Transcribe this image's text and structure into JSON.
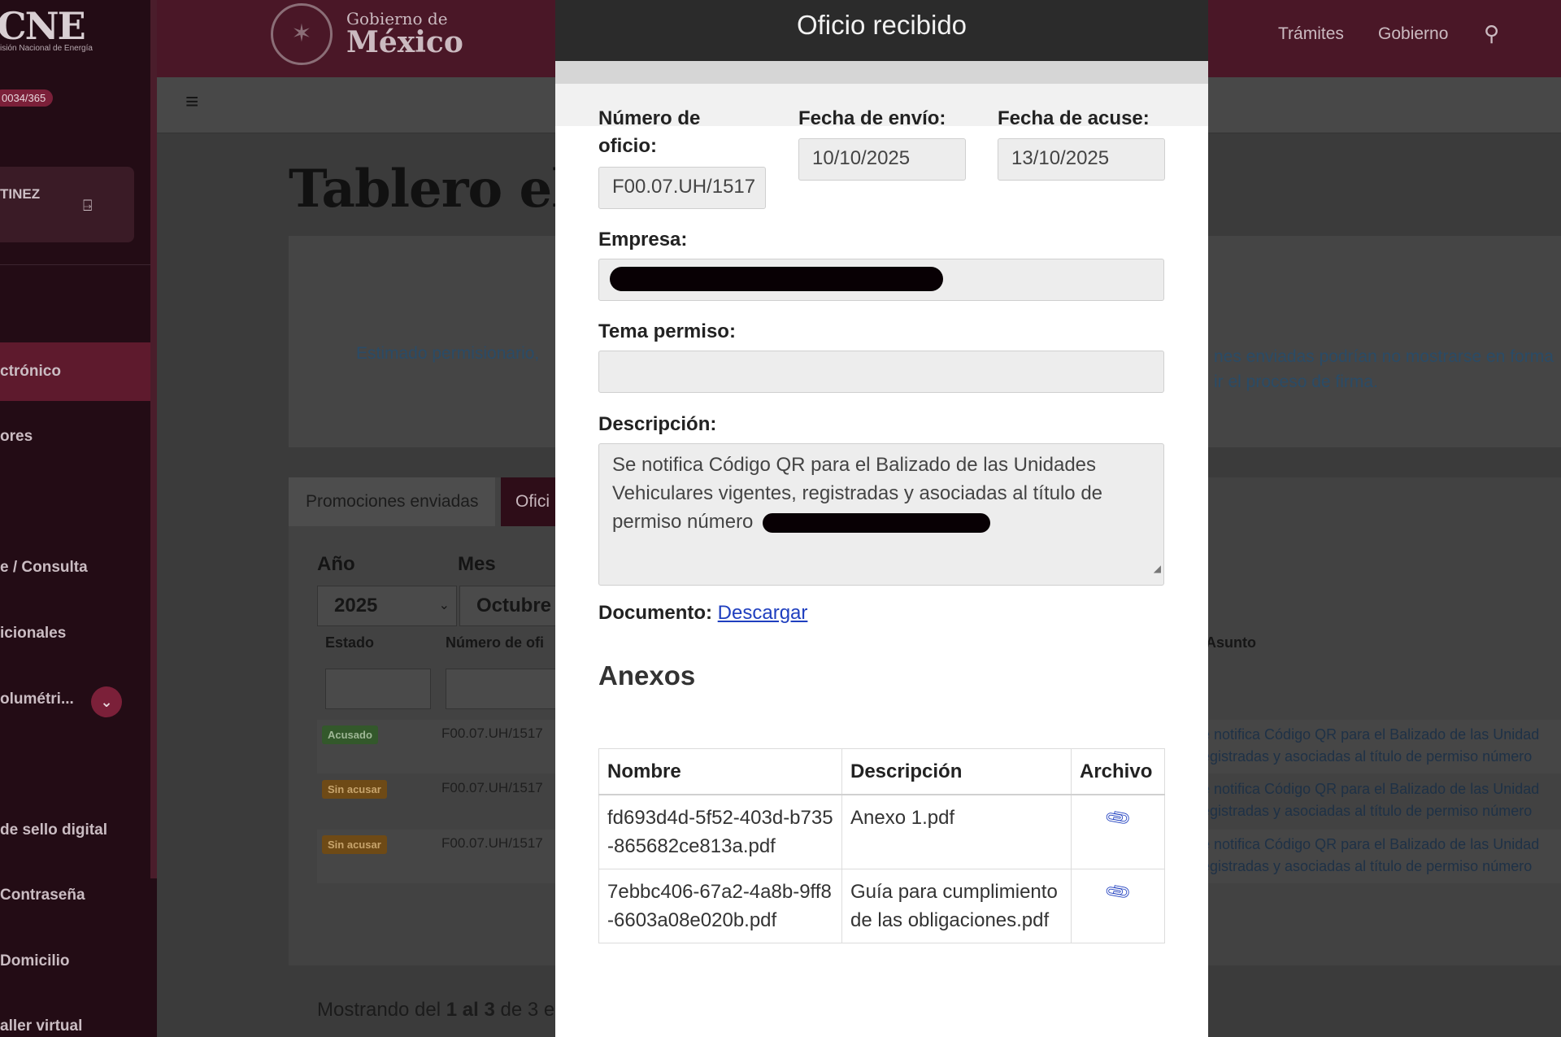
{
  "sidebar": {
    "logo": "CNE",
    "logo_sub": "isión Nacional de Energía",
    "counter": "0034/365",
    "user_name": "TINEZ",
    "items": [
      {
        "label": "ctrónico"
      },
      {
        "label": "ores"
      },
      {
        "label": "e / Consulta"
      },
      {
        "label": "icionales"
      },
      {
        "label": "olumétri..."
      },
      {
        "label": "de sello digital"
      },
      {
        "label": "Contraseña"
      },
      {
        "label": "Domicilio"
      },
      {
        "label": "aller virtual"
      }
    ]
  },
  "header": {
    "gob_small": "Gobierno de",
    "gob_big": "México",
    "nav": [
      "Trámites",
      "Gobierno"
    ]
  },
  "main": {
    "page_title": "Tablero el",
    "notice_left": "Estimado permisionario,",
    "notice_right_1": "nes enviadas podrían no mostrarse en forma",
    "notice_right_2": "ir el proceso de firma.",
    "tabs": [
      "Promociones enviadas",
      "Ofici"
    ],
    "filter_year_label": "Año",
    "filter_month_label": "Mes",
    "year_value": "2025",
    "month_value": "Octubre",
    "columns": [
      "Estado",
      "Número de ofi",
      "Asunto"
    ],
    "rows": [
      {
        "status": "Acusado",
        "numero": "F00.07.UH/1517",
        "asunto_1": "e notifica Código QR para el Balizado de las Unidad",
        "asunto_2": "egistradas y asociadas al título de permiso número"
      },
      {
        "status": "Sin acusar",
        "numero": "F00.07.UH/1517",
        "asunto_1": "e notifica Código QR para el Balizado de las Unidad",
        "asunto_2": "egistradas y asociadas al título de permiso número"
      },
      {
        "status": "Sin acusar",
        "numero": "F00.07.UH/1517",
        "asunto_1": "e notifica Código QR para el Balizado de las Unidad",
        "asunto_2": "egistradas y asociadas al título de permiso número"
      }
    ],
    "footer_prefix": "Mostrando del",
    "footer_range": "1 al 3",
    "footer_suffix": "de 3 e"
  },
  "modal": {
    "title": "Oficio recibido",
    "numero_label_1": "Número de",
    "numero_label_2": "oficio:",
    "numero_value": "F00.07.UH/1517",
    "fecha_envio_label": "Fecha de envío:",
    "fecha_envio_value": "10/10/2025",
    "fecha_acuse_label": "Fecha de acuse:",
    "fecha_acuse_value": "13/10/2025",
    "empresa_label": "Empresa:",
    "empresa_value": "",
    "tema_label": "Tema permiso:",
    "tema_value": "",
    "descripcion_label": "Descripción:",
    "descripcion_value": "Se notifica Código QR para el Balizado de las Unidades Vehiculares vigentes, registradas y asociadas al título de permiso número",
    "documento_label": "Documento:",
    "documento_link": "Descargar",
    "anexos_title": "Anexos",
    "anexos_columns": [
      "Nombre",
      "Descripción",
      "Archivo"
    ],
    "anexos": [
      {
        "nombre": "fd693d4d-5f52-403d-b735-865682ce813a.pdf",
        "descripcion": "Anexo 1.pdf",
        "archivo_icon": "paperclip-icon"
      },
      {
        "nombre": "7ebbc406-67a2-4a8b-9ff8-6603a08e020b.pdf",
        "descripcion": "Guía para cumplimiento de las obligaciones.pdf",
        "archivo_icon": "paperclip-icon"
      }
    ]
  },
  "colors": {
    "brand_dark": "#4a1727",
    "brand_accent": "#7b2039",
    "modal_header": "#2b2b2b",
    "link": "#1f3fbf",
    "badge_acusado": "#33582b",
    "badge_sin_acusar": "#6e4a16"
  }
}
